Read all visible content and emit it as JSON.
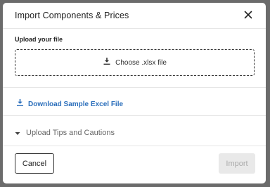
{
  "dialog": {
    "title": "Import Components & Prices",
    "upload_label": "Upload your file",
    "choose_file_label": "Choose .xlsx file",
    "download_sample_label": "Download Sample Excel File",
    "tips_label": "Upload Tips and Cautions",
    "cancel_label": "Cancel",
    "import_label": "Import"
  },
  "icons": {
    "close": "close-icon",
    "upload": "download-icon",
    "download": "download-icon",
    "expand": "caret-down-icon"
  },
  "colors": {
    "link": "#2a6ebb",
    "disabled_button_bg": "#e9e9e9",
    "disabled_button_text": "#aaaaaa"
  }
}
